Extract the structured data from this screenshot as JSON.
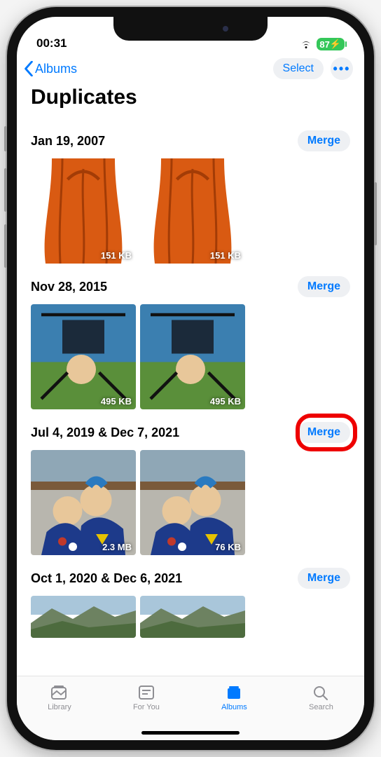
{
  "status": {
    "time": "00:31",
    "battery": "87",
    "charging_glyph": "⚡"
  },
  "nav": {
    "back_label": "Albums",
    "select_label": "Select",
    "more_glyph": "•••"
  },
  "page": {
    "title": "Duplicates"
  },
  "merge_label": "Merge",
  "groups": [
    {
      "date": "Jan 19, 2007",
      "items": [
        {
          "size": "151 KB"
        },
        {
          "size": "151 KB"
        }
      ]
    },
    {
      "date": "Nov 28, 2015",
      "items": [
        {
          "size": "495 KB"
        },
        {
          "size": "495 KB"
        }
      ]
    },
    {
      "date": "Jul 4, 2019 & Dec 7, 2021",
      "items": [
        {
          "size": "2.3 MB"
        },
        {
          "size": "76 KB"
        }
      ],
      "highlighted": true
    },
    {
      "date": "Oct 1, 2020 & Dec 6, 2021",
      "items": [
        {
          "size": ""
        },
        {
          "size": ""
        }
      ]
    }
  ],
  "tabs": {
    "library": "Library",
    "foryou": "For You",
    "albums": "Albums",
    "search": "Search"
  }
}
